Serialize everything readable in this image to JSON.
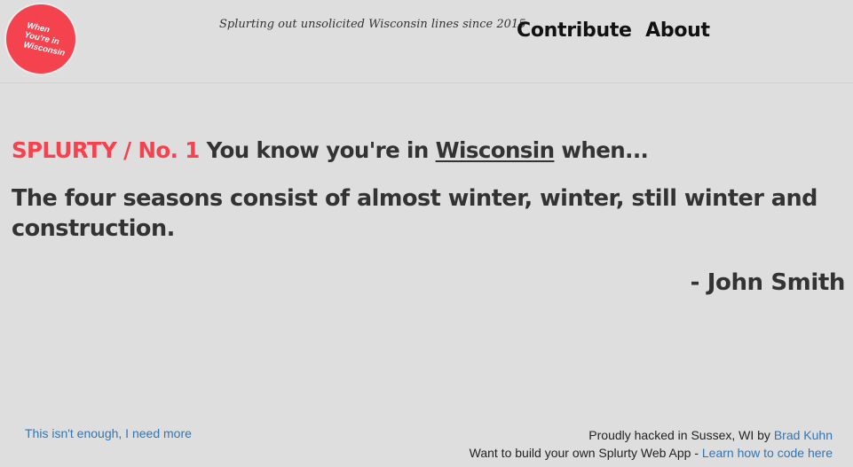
{
  "header": {
    "logo": {
      "line1": "When",
      "line2": "You're in",
      "line3": "Wisconsin"
    },
    "tagline": "Splurting out unsolicited Wisconsin lines since 2015",
    "nav": {
      "contribute": "Contribute",
      "about": "About"
    }
  },
  "main": {
    "brand": "SPLURTY / No. 1",
    "prefix": "You know you're in",
    "state": "Wisconsin",
    "suffix": "when...",
    "quote": "The four seasons consist of almost winter, winter, still winter and construction.",
    "author": "- John Smith"
  },
  "footer": {
    "more_link": "This isn't enough, I need more",
    "credit_text": "Proudly hacked in Sussex, WI by",
    "credit_link": "Brad Kuhn",
    "build_text": "Want to build your own Splurty Web App -",
    "build_link": "Learn how to code here"
  },
  "colors": {
    "background": "#dedede",
    "accent": "#f4424e",
    "link": "#2f76b8",
    "text": "#333333"
  }
}
